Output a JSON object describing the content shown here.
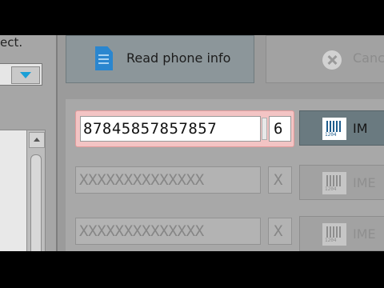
{
  "left_panel": {
    "select_prompt_fragment": "ect."
  },
  "toolbar": {
    "read_phone_info_label": "Read phone info",
    "cancel_label": "Canc"
  },
  "imei_rows": [
    {
      "imei_value": "87845857857857",
      "check_digit": "6",
      "button_label": "IM",
      "enabled": true
    },
    {
      "imei_value": "XXXXXXXXXXXXXX",
      "check_digit": "X",
      "button_label": "IME",
      "enabled": false
    },
    {
      "imei_value": "XXXXXXXXXXXXXX",
      "check_digit": "X",
      "button_label": "IME",
      "enabled": false
    }
  ],
  "barcode_icon_number": "1204",
  "colors": {
    "active_row_highlight": "#f3c4c4",
    "primary_button": "#6a7a80",
    "dropdown_arrow": "#1a9fd6",
    "document_icon": "#2a86cf"
  }
}
